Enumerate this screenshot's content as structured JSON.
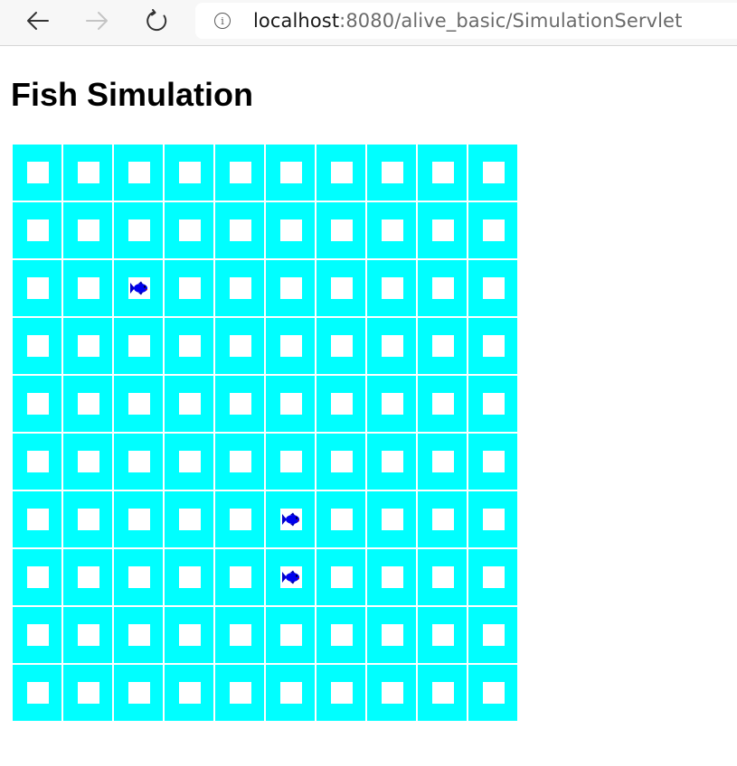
{
  "browser": {
    "url_host": "localhost",
    "url_rest": ":8080/alive_basic/SimulationServlet",
    "info_glyph": "i",
    "icons": [
      "back-icon",
      "forward-icon",
      "reload-icon",
      "info-icon"
    ]
  },
  "page": {
    "title": "Fish Simulation"
  },
  "grid": {
    "rows": 10,
    "cols": 10,
    "cell_color": "#00ffff",
    "inner_color": "#ffffff",
    "fish": [
      {
        "row": 2,
        "col": 2
      },
      {
        "row": 6,
        "col": 5
      },
      {
        "row": 7,
        "col": 5
      }
    ]
  }
}
